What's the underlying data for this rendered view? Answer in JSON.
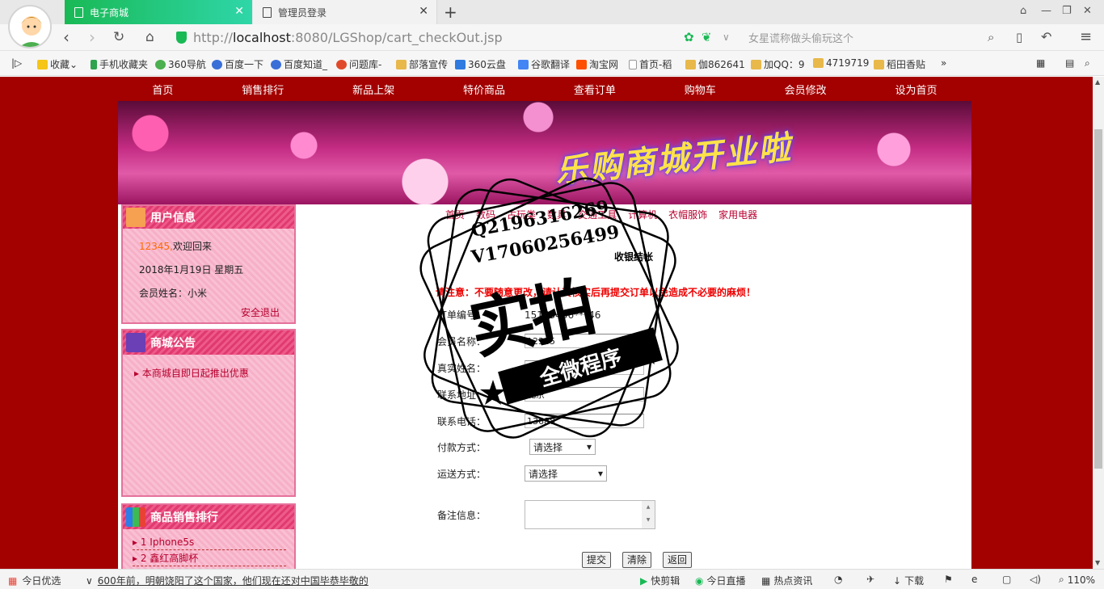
{
  "browser": {
    "tabs": [
      {
        "label": "电子商城",
        "active": true
      },
      {
        "label": "管理员登录",
        "active": false
      }
    ],
    "url_prefix": "http://",
    "url_host": "localhost",
    "url_rest": ":8080/LGShop/cart_checkOut.jsp",
    "search_placeholder": "女星谎称做头偷玩这个",
    "bookmarks": [
      "收藏",
      "手机收藏夹",
      "360导航",
      "百度一下",
      "百度知道_",
      "问题库-",
      "部落宣传",
      "360云盘",
      "谷歌翻译",
      "淘宝网",
      "首页-稻",
      "伽862641",
      "加QQ：9",
      "4719719",
      "稻田香贴"
    ],
    "accent_color": "#19b955"
  },
  "site": {
    "nav": [
      "首页",
      "销售排行",
      "新品上架",
      "特价商品",
      "查看订单",
      "购物车",
      "会员修改",
      "设为首页"
    ],
    "banner_title": "乐购商城开业啦",
    "bg_color": "#a30000",
    "categories": [
      "首页",
      "数码",
      "古玩类",
      "数具",
      "交通工具",
      "计算机",
      "衣帽服饰",
      "家用电器"
    ]
  },
  "user_box": {
    "title": "用户信息",
    "user_id": "12345,",
    "welcome": "欢迎回来",
    "date": "2018年1月19日 星期五",
    "member_name": "会员姓名：小米",
    "logout": "安全退出"
  },
  "notice_box": {
    "title": "商城公告",
    "item": "本商城自即日起推出优惠"
  },
  "rank_box": {
    "title": "商品销售排行",
    "items": [
      "1  Iphone5s",
      "2  鑫红高脚杯"
    ]
  },
  "checkout": {
    "title": "收银结帐",
    "warning": "请注意：不要随意更改，请认真核实后再提交订单以免造成不必要的麻烦！",
    "fields": [
      {
        "label": "订单编号：",
        "value": "15163436***46"
      },
      {
        "label": "会员名称：",
        "value": "12345"
      },
      {
        "label": "真实姓名：",
        "value": ""
      },
      {
        "label": "联系地址：",
        "value": "北京"
      },
      {
        "label": "联系电话：",
        "value": "13688"
      }
    ],
    "payment_label": "付款方式：",
    "payment_value": "请选择",
    "shipping_label": "运送方式：",
    "shipping_value": "请选择",
    "remark_label": "备注信息：",
    "buttons": [
      "提交",
      "清除",
      "返回"
    ]
  },
  "stamp": {
    "line1": "Q2196316269",
    "line2": "V17060256499",
    "big": "实拍",
    "band": "全微程序"
  },
  "statusbar": {
    "left": "今日优选",
    "headline": "600年前，明朝饶阳了这个国家，他们现在还对中国毕恭毕敬的",
    "items": [
      "快剪辑",
      "今日直播",
      "热点资讯",
      "下载"
    ],
    "zoom": "110%"
  }
}
